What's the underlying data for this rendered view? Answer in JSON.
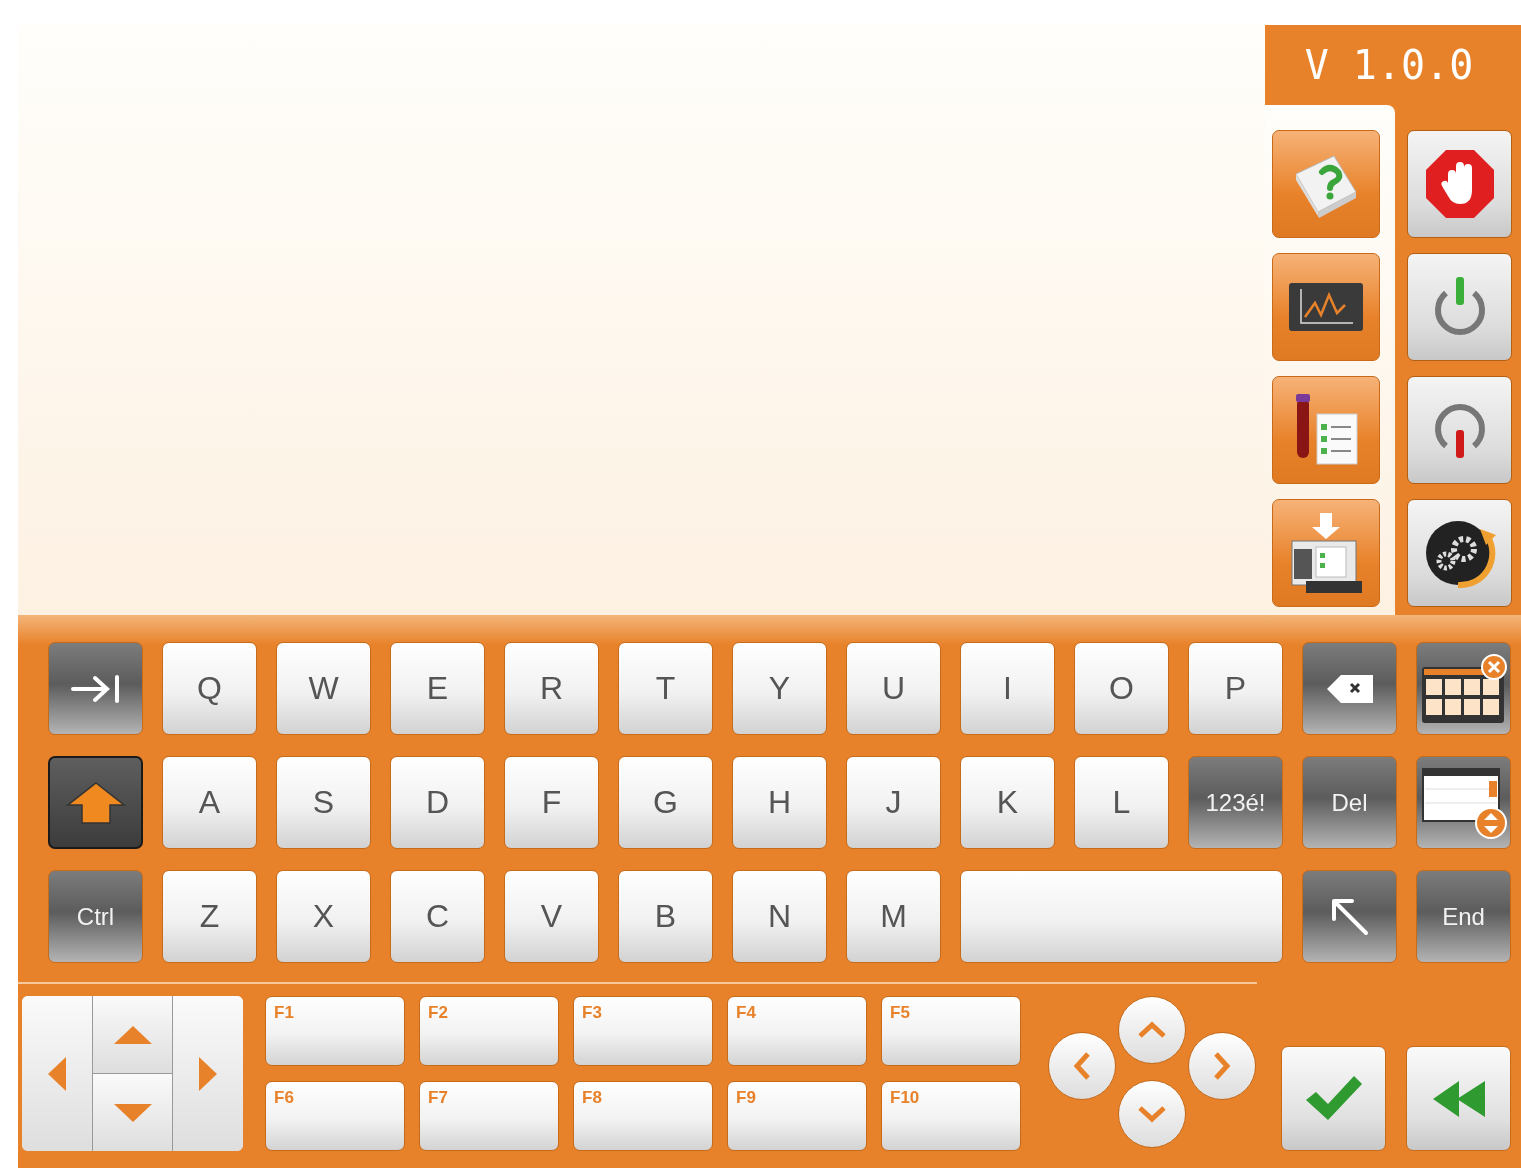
{
  "version": "V 1.0.0",
  "keyboard": {
    "rows": [
      [
        {
          "kind": "tab",
          "on": false
        },
        {
          "kind": "letter",
          "label": "Q",
          "on": false
        },
        {
          "kind": "letter",
          "label": "W",
          "on": false
        },
        {
          "kind": "letter",
          "label": "E",
          "on": false
        },
        {
          "kind": "letter",
          "label": "R",
          "on": false
        },
        {
          "kind": "letter",
          "label": "T",
          "on": false
        },
        {
          "kind": "letter",
          "label": "Y",
          "on": false
        },
        {
          "kind": "letter",
          "label": "U",
          "on": false
        },
        {
          "kind": "letter",
          "label": "I",
          "on": false
        },
        {
          "kind": "letter",
          "label": "O",
          "on": false
        },
        {
          "kind": "letter",
          "label": "P",
          "on": false
        },
        {
          "kind": "backspace",
          "on": false
        },
        {
          "kind": "hide",
          "on": false
        }
      ],
      [
        {
          "kind": "shift",
          "on": true
        },
        {
          "kind": "letter",
          "label": "A",
          "on": false
        },
        {
          "kind": "letter",
          "label": "S",
          "on": false
        },
        {
          "kind": "letter",
          "label": "D",
          "on": false
        },
        {
          "kind": "letter",
          "label": "F",
          "on": false
        },
        {
          "kind": "letter",
          "label": "G",
          "on": false
        },
        {
          "kind": "letter",
          "label": "H",
          "on": false
        },
        {
          "kind": "letter",
          "label": "J",
          "on": false
        },
        {
          "kind": "letter",
          "label": "K",
          "on": false
        },
        {
          "kind": "letter",
          "label": "L",
          "on": false
        },
        {
          "kind": "dark",
          "label": "123é!",
          "on": false
        },
        {
          "kind": "dark",
          "label": "Del",
          "on": false
        },
        {
          "kind": "scroll",
          "on": false
        }
      ],
      [
        {
          "kind": "dark",
          "label": "Ctrl",
          "on": false
        },
        {
          "kind": "letter",
          "label": "Z",
          "on": false
        },
        {
          "kind": "letter",
          "label": "X",
          "on": false
        },
        {
          "kind": "letter",
          "label": "C",
          "on": false
        },
        {
          "kind": "letter",
          "label": "V",
          "on": false
        },
        {
          "kind": "letter",
          "label": "B",
          "on": false
        },
        {
          "kind": "letter",
          "label": "N",
          "on": false
        },
        {
          "kind": "letter",
          "label": "M",
          "on": false
        },
        {
          "kind": "space",
          "on": false
        },
        {
          "kind": "home",
          "on": false
        },
        {
          "kind": "dark",
          "label": "End",
          "on": false
        }
      ]
    ]
  },
  "function_keys": [
    "F1",
    "F2",
    "F3",
    "F4",
    "F5",
    "F6",
    "F7",
    "F8",
    "F9",
    "F10"
  ]
}
